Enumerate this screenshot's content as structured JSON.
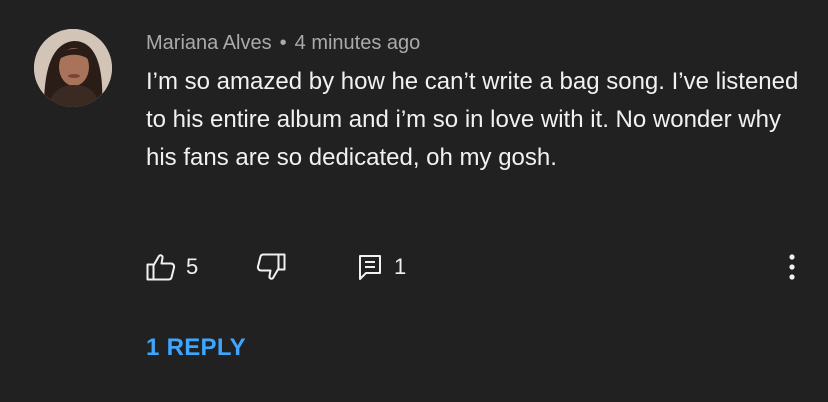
{
  "comment": {
    "author": "Mariana Alves",
    "separator": "•",
    "timestamp": "4 minutes ago",
    "text": "I’m so amazed by how he can’t write a bag song. I’ve listened to his entire album and i’m so in love with it. No wonder why his fans are so dedicated, oh my gosh."
  },
  "actions": {
    "like_icon": "thumbs-up-icon",
    "like_count": "5",
    "dislike_icon": "thumbs-down-icon",
    "reply_icon": "comment-icon",
    "reply_count": "1",
    "more_icon": "more-vertical-icon"
  },
  "replies": {
    "label": "1 REPLY"
  },
  "colors": {
    "background": "#212121",
    "text": "#f1f1f1",
    "muted": "#aaaaaa",
    "link": "#3ea6ff"
  }
}
